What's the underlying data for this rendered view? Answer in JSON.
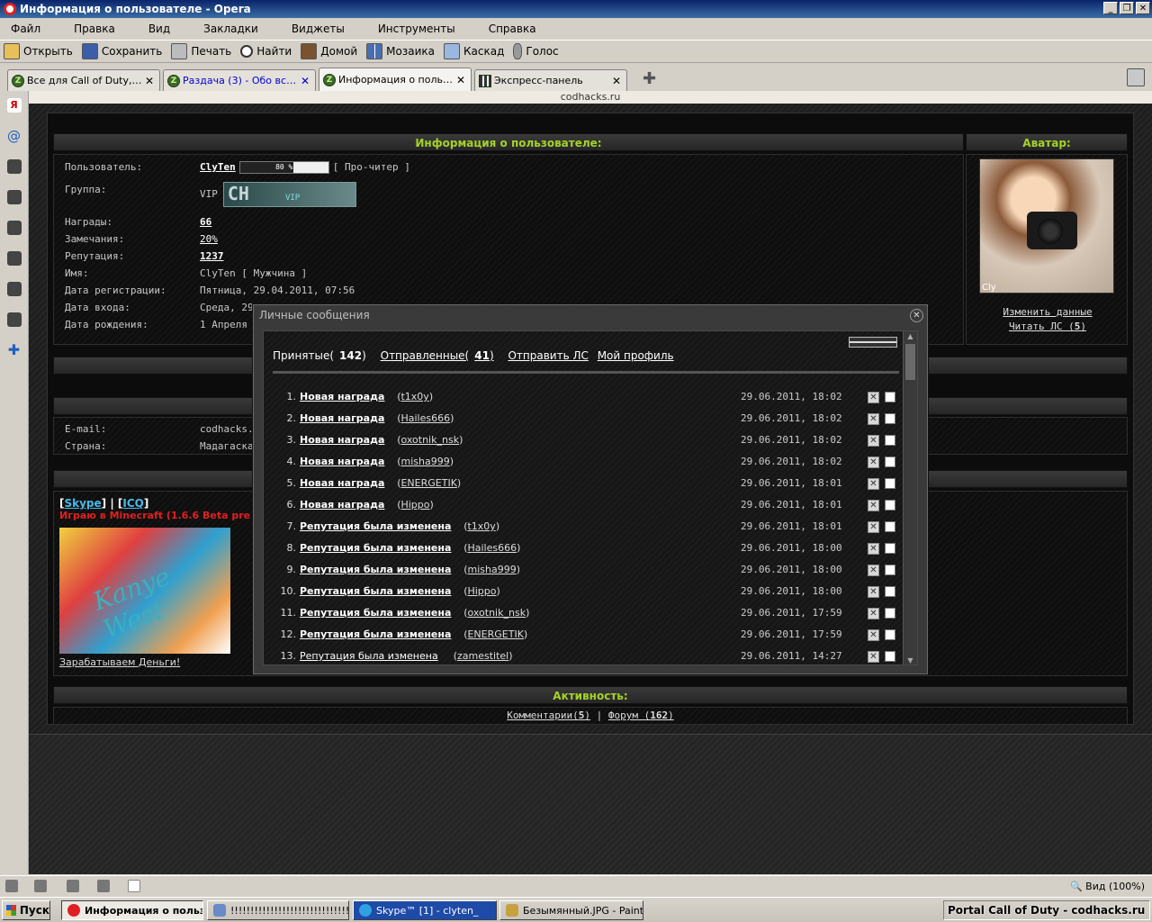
{
  "window": {
    "title": "Информация о пользователе - Opera"
  },
  "menu": [
    "Файл",
    "Правка",
    "Вид",
    "Закладки",
    "Виджеты",
    "Инструменты",
    "Справка"
  ],
  "toolbar": {
    "open": "Открыть",
    "save": "Сохранить",
    "print": "Печать",
    "find": "Найти",
    "home": "Домой",
    "mosaic": "Мозаика",
    "cascade": "Каскад",
    "voice": "Голос"
  },
  "tabs": [
    {
      "label": "Все для Call of Duty, Ва..."
    },
    {
      "label": "Раздача (3) - Обо всем ..."
    },
    {
      "label": "Информация о пользов..."
    },
    {
      "label": "Экспресс-панель"
    }
  ],
  "address": "codhacks.ru",
  "profile": {
    "header": "Информация о пользователе:",
    "avatar_header": "Аватар:",
    "avatar_signature": "Cly",
    "user_label": "Пользователь:",
    "user_name": "ClyTen",
    "user_bar_text": "80 %",
    "user_rank": "[ Про-читер ]",
    "group_label": "Группа:",
    "group_value": "VIP",
    "group_badge_logo": "CH",
    "group_badge_text": "VIP",
    "awards_label": "Награды:",
    "awards_value": "66",
    "warnings_label": "Замечания:",
    "warnings_value": "20%",
    "rep_label": "Репутация:",
    "rep_value": "1237",
    "name_label": "Имя:",
    "name_value": "ClyTen [ Мужчина ]",
    "reg_label": "Дата регистрации:",
    "reg_value": "Пятница, 29.04.2011, 07:56",
    "login_label": "Дата входа:",
    "login_value": "Среда, 29.0",
    "birth_label": "Дата рождения:",
    "birth_value": "1 Апреля 2",
    "edit_link": "Изменить данные",
    "read_pm_link": "Читать ЛС (",
    "read_pm_count": "5",
    "read_pm_end": ")",
    "email_label": "E-mail:",
    "email_value": "codhacks.m",
    "country_label": "Страна:",
    "country_value": "Мадагаскар",
    "skype_link": "Skype",
    "icq_link": "ICQ",
    "status_text": "Играю в Minecraft (1.6.6 Beta pre",
    "sig_image_text": "Kanye West",
    "earn_link": "Зарабатываем Деньги!",
    "activity_header": "Активность:",
    "comments_label": "Комментарии(",
    "comments_count": "5",
    "comments_end": ")",
    "forum_label": "Форум (",
    "forum_count": "162",
    "forum_end": ")"
  },
  "modal": {
    "title": "Личные сообщения",
    "inbox_label": "Принятые(",
    "inbox_count": "142",
    "inbox_end": ")",
    "sent_label": "Отправленные(",
    "sent_count": "41",
    "sent_end": ")",
    "send_link": "Отправить ЛС",
    "profile_link": "Мой профиль",
    "messages": [
      {
        "num": "1.",
        "subject": "Новая награда",
        "from": "t1x0y",
        "date": "29.06.2011, 18:02",
        "bold": true
      },
      {
        "num": "2.",
        "subject": "Новая награда",
        "from": "Hailes666",
        "date": "29.06.2011, 18:02",
        "bold": true
      },
      {
        "num": "3.",
        "subject": "Новая награда",
        "from": "oxotnik_nsk",
        "date": "29.06.2011, 18:02",
        "bold": true
      },
      {
        "num": "4.",
        "subject": "Новая награда",
        "from": "misha999",
        "date": "29.06.2011, 18:02",
        "bold": true
      },
      {
        "num": "5.",
        "subject": "Новая награда",
        "from": "ENERGETIK",
        "date": "29.06.2011, 18:01",
        "bold": true
      },
      {
        "num": "6.",
        "subject": "Новая награда",
        "from": "Hippo",
        "date": "29.06.2011, 18:01",
        "bold": true
      },
      {
        "num": "7.",
        "subject": "Репутация была изменена",
        "from": "t1x0y",
        "date": "29.06.2011, 18:01",
        "bold": true
      },
      {
        "num": "8.",
        "subject": "Репутация была изменена",
        "from": "Hailes666",
        "date": "29.06.2011, 18:00",
        "bold": true
      },
      {
        "num": "9.",
        "subject": "Репутация была изменена",
        "from": "misha999",
        "date": "29.06.2011, 18:00",
        "bold": true
      },
      {
        "num": "10.",
        "subject": "Репутация была изменена",
        "from": "Hippo",
        "date": "29.06.2011, 18:00",
        "bold": true
      },
      {
        "num": "11.",
        "subject": "Репутация была изменена",
        "from": "oxotnik_nsk",
        "date": "29.06.2011, 17:59",
        "bold": true
      },
      {
        "num": "12.",
        "subject": "Репутация была изменена",
        "from": "ENERGETIK",
        "date": "29.06.2011, 17:59",
        "bold": true
      },
      {
        "num": "13.",
        "subject": "Репутация была изменена",
        "from": "zamestitel",
        "date": "29.06.2011, 14:27",
        "bold": false
      }
    ]
  },
  "statusbar": {
    "zoom": "Вид (100%)"
  },
  "taskbar": {
    "start": "Пуск",
    "tasks": [
      {
        "label": "Информация о польз..."
      },
      {
        "label": "!!!!!!!!!!!!!!!!!!!!!!!!!!!!!!!..."
      },
      {
        "label": "Skype™ [1] - clyten_"
      },
      {
        "label": "Безымянный.JPG - Paint"
      }
    ],
    "tray_text": "Portal Call of Duty - codhacks.ru"
  }
}
